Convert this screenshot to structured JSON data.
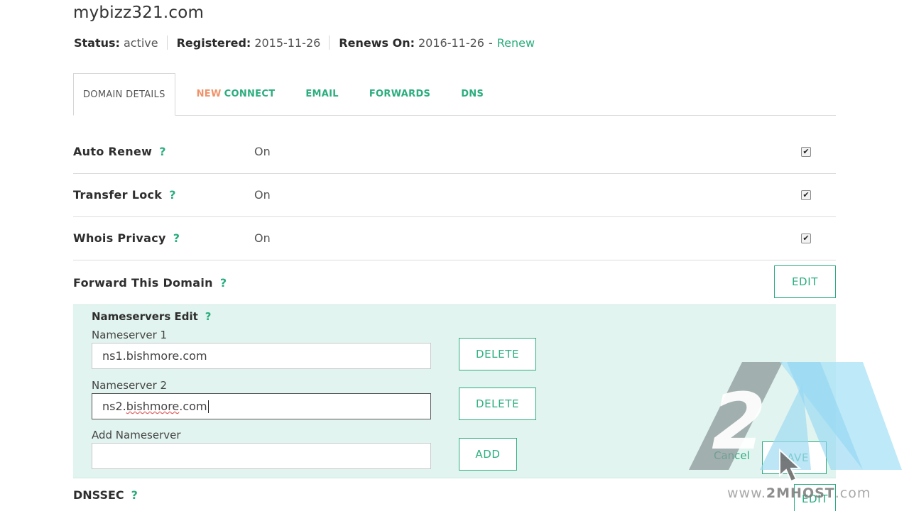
{
  "domain": {
    "title": "mybizz321.com"
  },
  "status": {
    "status_label": "Status:",
    "status_value": "active",
    "registered_label": "Registered:",
    "registered_value": "2015-11-26",
    "renews_label": "Renews On:",
    "renews_value": "2016-11-26",
    "dash": "-",
    "renew_link": "Renew"
  },
  "tabs": [
    {
      "label": "DOMAIN DETAILS"
    },
    {
      "badge": "NEW",
      "label": "CONNECT"
    },
    {
      "label": "EMAIL"
    },
    {
      "label": "FORWARDS"
    },
    {
      "label": "DNS"
    }
  ],
  "help_glyph": "?",
  "settings": {
    "auto_renew": {
      "label": "Auto Renew",
      "value": "On",
      "checked": true
    },
    "transfer_lock": {
      "label": "Transfer Lock",
      "value": "On",
      "checked": true
    },
    "whois_privacy": {
      "label": "Whois Privacy",
      "value": "On",
      "checked": true
    },
    "forward": {
      "label": "Forward This Domain",
      "edit_label": "EDIT"
    }
  },
  "nameservers": {
    "title": "Nameservers Edit",
    "ns1": {
      "label": "Nameserver 1",
      "value": "ns1.bishmore.com",
      "delete_label": "DELETE"
    },
    "ns2": {
      "label": "Nameserver 2",
      "value_prefix": "ns2.",
      "value_misspelled": "bishmore",
      "value_suffix": ".com",
      "delete_label": "DELETE"
    },
    "add": {
      "label": "Add Nameserver",
      "value": "",
      "add_label": "ADD"
    },
    "cancel_label": "Cancel",
    "save_label": "SAVE"
  },
  "dnssec": {
    "label": "DNSSEC",
    "edit_label": "EDIT"
  },
  "watermark": {
    "prefix": "www.",
    "brand": "2MHOST",
    "suffix": ".com",
    "logo_text": "2"
  },
  "colors": {
    "accent": "#2bad7e",
    "new_badge": "#f0926a",
    "panel_bg": "#e2f4ef"
  },
  "icons": {
    "checkbox": "checkbox-checked-icon",
    "cursor": "mouse-pointer-icon",
    "help": "help-icon"
  }
}
